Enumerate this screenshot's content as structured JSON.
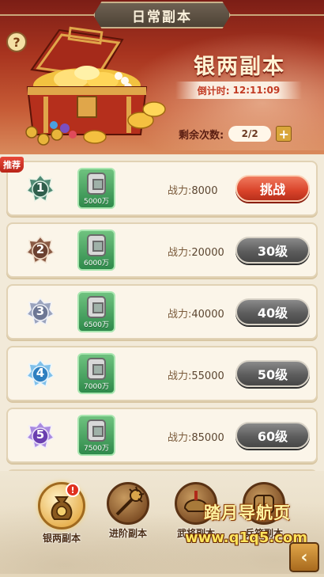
{
  "header": {
    "title": "日常副本",
    "help_icon": "question-icon",
    "dungeon_name": "银两副本",
    "countdown_label": "倒计时:",
    "countdown_value": "12:11:09",
    "remaining_label": "剩余次数:",
    "remaining_value": "2/2",
    "plus_label": "+"
  },
  "recommend_tag": "推荐",
  "stages": [
    {
      "badge": "1",
      "badge_color": "#4f8a74",
      "reward": "5000万",
      "power_label": "战力:",
      "power": "8000",
      "button": "挑战",
      "button_state": "active"
    },
    {
      "badge": "2",
      "badge_color": "#8a5a44",
      "reward": "6000万",
      "power_label": "战力:",
      "power": "20000",
      "button": "30级",
      "button_state": "locked"
    },
    {
      "badge": "3",
      "badge_color": "#7d86a3",
      "reward": "6500万",
      "power_label": "战力:",
      "power": "40000",
      "button": "40级",
      "button_state": "locked"
    },
    {
      "badge": "4",
      "badge_color": "#3a8fd0",
      "reward": "7000万",
      "power_label": "战力:",
      "power": "55000",
      "button": "50级",
      "button_state": "locked"
    },
    {
      "badge": "5",
      "badge_color": "#7b4fc0",
      "reward": "7500万",
      "power_label": "战力:",
      "power": "85000",
      "button": "60级",
      "button_state": "locked"
    }
  ],
  "bottom_nav": [
    {
      "label": "银两副本",
      "icon": "money-bag-icon",
      "active": true,
      "alert": "!"
    },
    {
      "label": "进阶副本",
      "icon": "spiked-mace-icon",
      "active": false
    },
    {
      "label": "武将副本",
      "icon": "general-helmet-icon",
      "active": false
    },
    {
      "label": "兵符副本",
      "icon": "tiger-tally-icon",
      "active": false
    }
  ],
  "watermark": {
    "line1": "踏月导航页",
    "line2": "www.q1q5.com"
  },
  "back_label": "‹",
  "colors": {
    "accent_red": "#d9432a",
    "banner_red": "#a8341f",
    "locked_grey": "#5d5d5d",
    "reward_green": "#2f8a4b"
  }
}
